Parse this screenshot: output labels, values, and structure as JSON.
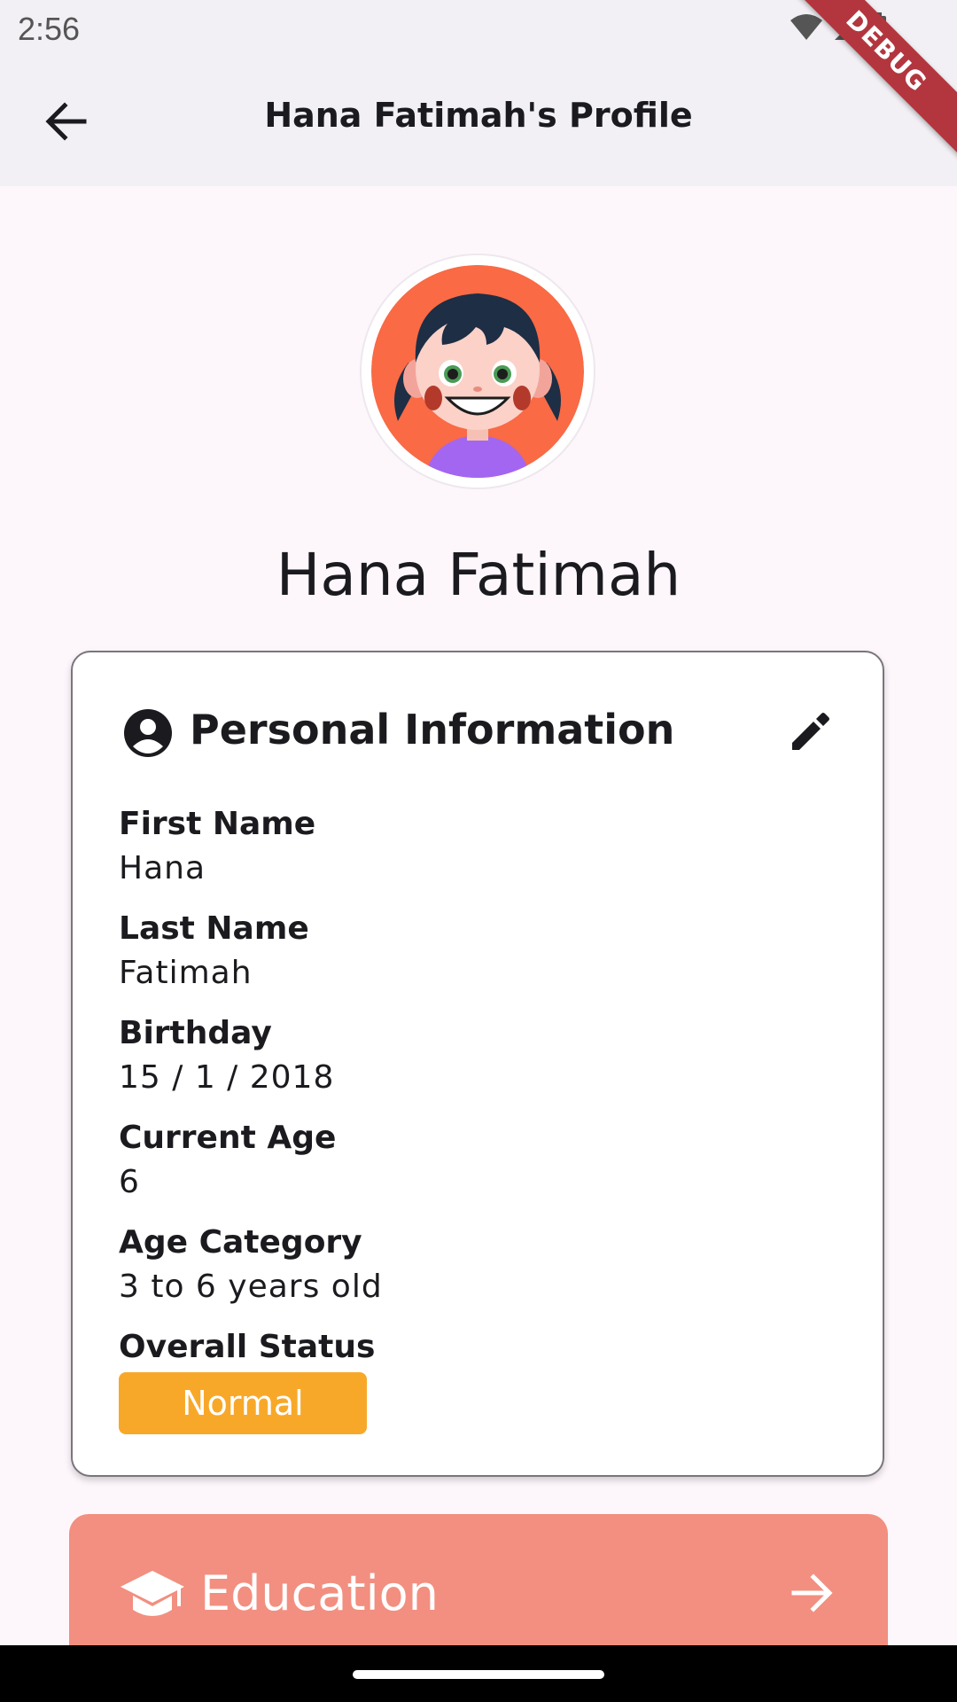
{
  "status_bar": {
    "time": "2:56",
    "icons": [
      "wifi-icon",
      "signal-icon",
      "battery-icon"
    ]
  },
  "app_bar": {
    "title": "Hana Fatimah's Profile",
    "back_icon": "arrow-left-icon"
  },
  "debug_banner": "DEBUG",
  "profile": {
    "name": "Hana Fatimah",
    "avatar": "girl-avatar-illustration"
  },
  "personal_info": {
    "title": "Personal Information",
    "header_icon": "account-circle-icon",
    "edit_icon": "pencil-icon",
    "fields": [
      {
        "label": "First Name",
        "value": "Hana"
      },
      {
        "label": "Last Name",
        "value": "Fatimah"
      },
      {
        "label": "Birthday",
        "value": "15 / 1 / 2018"
      },
      {
        "label": "Current Age",
        "value": "6"
      },
      {
        "label": "Age Category",
        "value": "3 to 6 years old"
      }
    ],
    "status_label": "Overall Status",
    "status_value": "Normal"
  },
  "education": {
    "label": "Education",
    "icon": "graduation-cap-icon",
    "arrow_icon": "arrow-right-icon"
  },
  "colors": {
    "status_badge": "#f8a829",
    "education_card": "#f28f80",
    "avatar_bg": "#f96a45"
  }
}
